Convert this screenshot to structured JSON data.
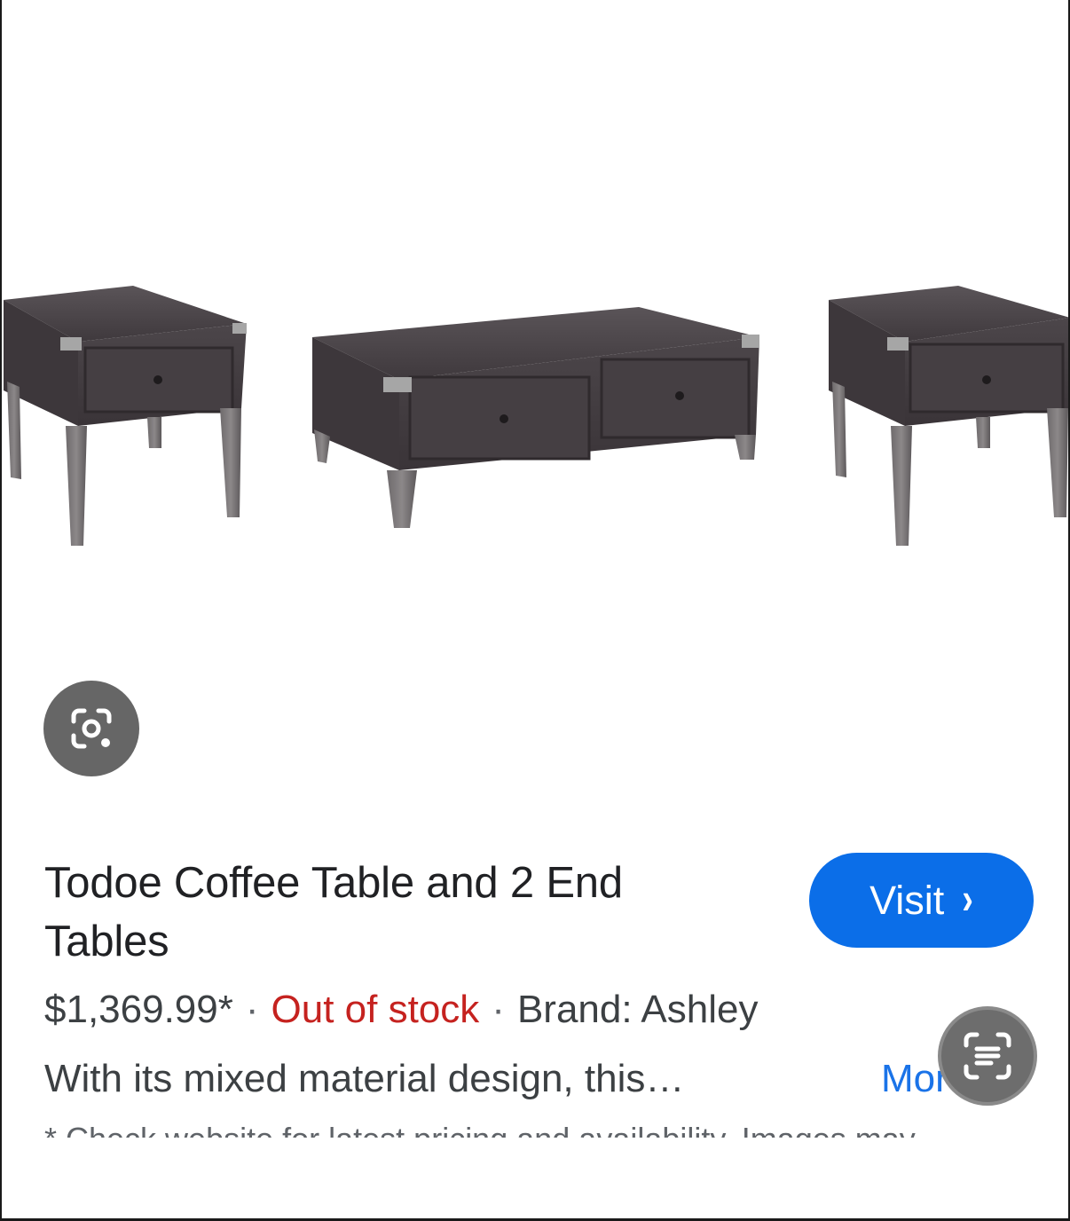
{
  "product": {
    "title": "Todoe Coffee Table and 2 End Tables",
    "price": "$1,369.99*",
    "separator": "·",
    "stock_status": "Out of stock",
    "brand": "Brand: Ashley",
    "description": "With its mixed material design, this…",
    "more_label": "More",
    "disclaimer": "* Check website for latest pricing and availability. Images may"
  },
  "actions": {
    "visit_label": "Visit",
    "visit_chevron": "›"
  },
  "icons": {
    "lens": "lens-camera-icon",
    "text_select": "text-select-icon",
    "product_image": "coffee-table-set-image"
  },
  "colors": {
    "visit_button": "#0b6ee8",
    "stock_out": "#c5221f",
    "link": "#1a73e8",
    "lens_button": "#666666",
    "furniture_wood": "#4a4448",
    "furniture_metal": "#9a9a9a"
  }
}
